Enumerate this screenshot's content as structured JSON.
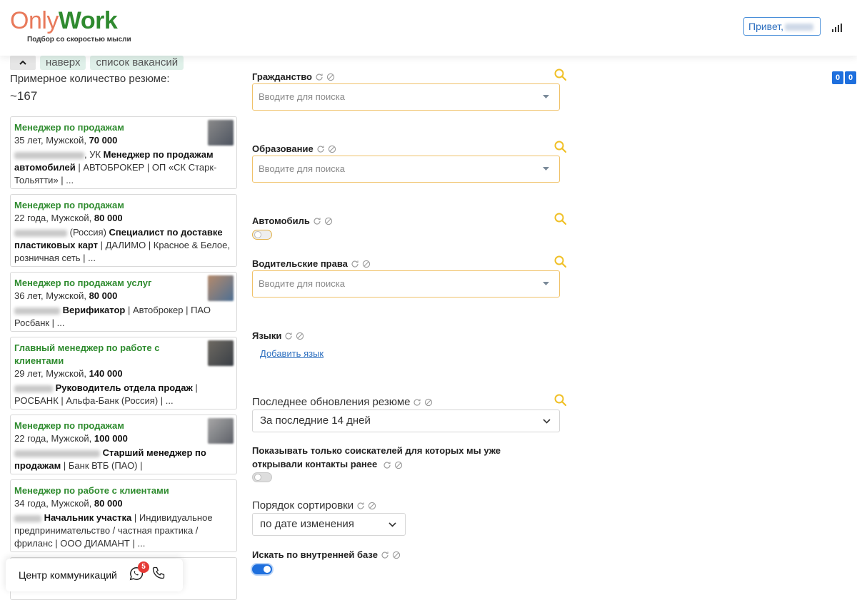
{
  "header": {
    "logo_only": "Only",
    "logo_work": "Work",
    "tagline": "Подбор со скоростью мысли",
    "greeting": "Привет,"
  },
  "nav": {
    "top": "наверх",
    "vacancies": "список вакансий"
  },
  "summary": {
    "label": "Примерное количество резюме:",
    "count": "~167"
  },
  "cards": [
    {
      "title": "Менеджер по продажам",
      "meta_prefix": "35 лет, Мужской, ",
      "salary": "70 000",
      "desc_pre": ", УК ",
      "desc_bold": "Менеджер по продажам автомобилей",
      "desc_post": " | АВТОБРОКЕР | ОП «СК Старк-Тольятти» | ..."
    },
    {
      "title": "Менеджер по продажам",
      "meta_prefix": "22 года, Мужской, ",
      "salary": "80 000",
      "desc_pre": " (Россия) ",
      "desc_bold": "Специалист по доставке пластиковых карт",
      "desc_post": " | ДАЛИМО | Красное & Белое, розничная сеть | ..."
    },
    {
      "title": "Менеджер по продажам услуг",
      "meta_prefix": "36 лет, Мужской, ",
      "salary": "80 000",
      "desc_pre": " ",
      "desc_bold": "Верификатор",
      "desc_post": " | Автоброкер | ПАО Росбанк | ..."
    },
    {
      "title": "Главный менеджер по работе с клиентами",
      "meta_prefix": "29 лет, Мужской, ",
      "salary": "140 000",
      "desc_pre": " ",
      "desc_bold": "Руководитель отдела продаж",
      "desc_post": " | РОСБАНК | Альфа-Банк (Россия) | ..."
    },
    {
      "title": "Менеджер по продажам",
      "meta_prefix": "22 года, Мужской, ",
      "salary": "100 000",
      "desc_pre": " ",
      "desc_bold": "Старший менеджер по продажам",
      "desc_post": " | Банк ВТБ (ПАО) |"
    },
    {
      "title": "Менеджер по работе с клиентами",
      "meta_prefix": "34 года, Мужской, ",
      "salary": "80 000",
      "desc_pre": " ",
      "desc_bold": "Начальник участка",
      "desc_post": " | Индивидуальное предпринимательство / частная практика / фриланс | ООО ДИАМАНТ | ..."
    }
  ],
  "communications": {
    "label": "Центр коммуникаций",
    "badge": "5"
  },
  "filters": {
    "citizenship": {
      "label": "Гражданство",
      "placeholder": "Вводите для поиска"
    },
    "education": {
      "label": "Образование",
      "placeholder": "Вводите для поиска"
    },
    "car": {
      "label": "Автомобиль"
    },
    "license": {
      "label": "Водительские права",
      "placeholder": "Вводите для поиска"
    },
    "languages": {
      "label": "Языки",
      "add": "Добавить язык"
    },
    "updated": {
      "label": "Последнее обновления резюме",
      "value": "За последние 14 дней"
    },
    "opened": {
      "label": "Показывать только соискателей для которых мы уже открывали контакты ранее"
    },
    "sort": {
      "label": "Порядок сортировки",
      "value": "по дате изменения"
    },
    "internal": {
      "label": "Искать по внутренней базе"
    }
  },
  "counter": {
    "a": "0",
    "b": "0"
  },
  "colors": {
    "accent": "#1e6fdd",
    "brand_green": "#2f8a2f",
    "brand_orange": "#e8795a",
    "highlight": "#f0c26a"
  }
}
